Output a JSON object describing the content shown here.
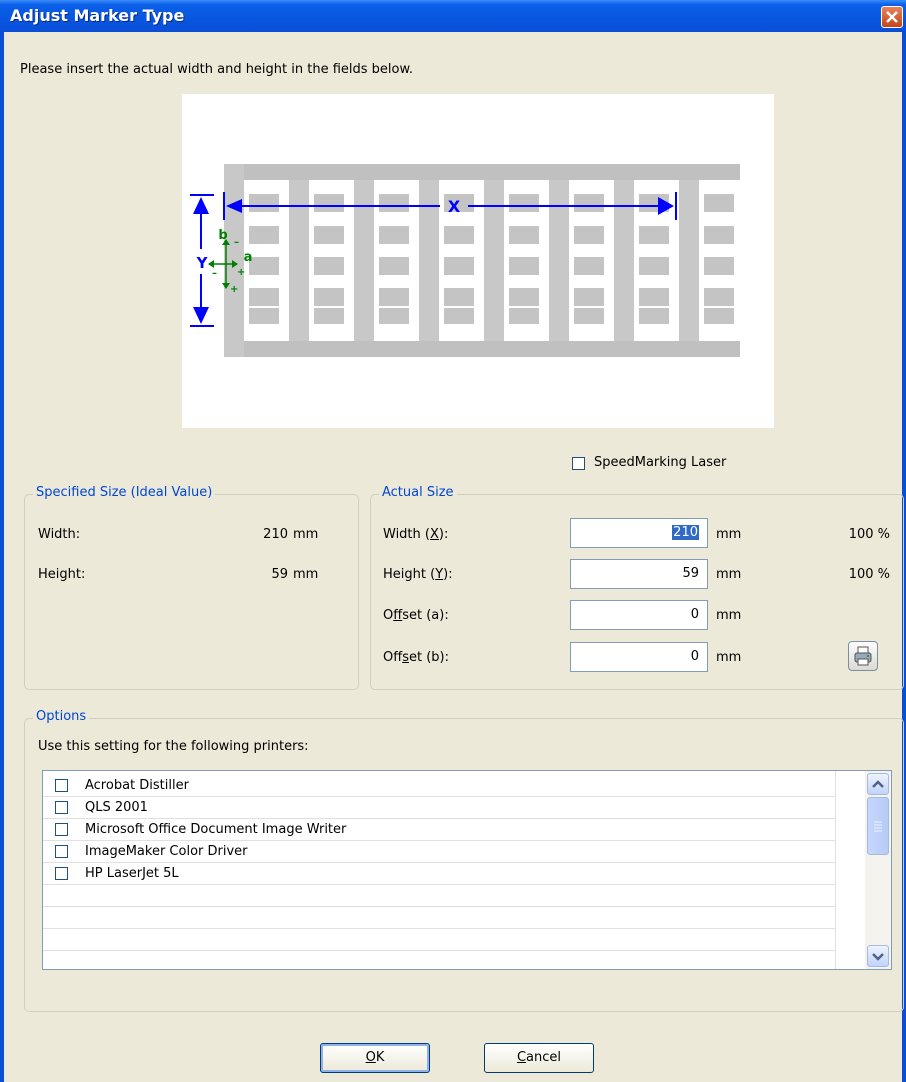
{
  "window": {
    "title": "Adjust Marker Type"
  },
  "instruction": "Please insert the actual width and height in the fields below.",
  "diagram": {
    "x_label": "X",
    "y_label": "Y",
    "a_label": "a",
    "b_label": "b",
    "plus": "+",
    "minus": "–"
  },
  "speedmarking": {
    "label": "SpeedMarking Laser",
    "checked": false
  },
  "specified": {
    "legend": "Specified Size (Ideal Value)",
    "width_label": "Width:",
    "width_value": "210",
    "width_unit": "mm",
    "height_label": "Height:",
    "height_value": "59",
    "height_unit": "mm"
  },
  "actual": {
    "legend": "Actual Size",
    "width_label_pre": "Width (",
    "width_label_key": "X",
    "width_label_post": "):",
    "width_value": "210",
    "width_unit": "mm",
    "width_pct": "100 %",
    "height_label_pre": "Height (",
    "height_label_key": "Y",
    "height_label_post": "):",
    "height_value": "59",
    "height_unit": "mm",
    "height_pct": "100 %",
    "offa_label_pre": "O",
    "offa_label_key": "f",
    "offa_label_post": "fset (a):",
    "offa_value": "0",
    "offa_unit": "mm",
    "offb_label_pre": "Off",
    "offb_label_key": "s",
    "offb_label_post": "et (b):",
    "offb_value": "0",
    "offb_unit": "mm"
  },
  "options": {
    "legend": "Options",
    "description": "Use this setting for the following printers:",
    "printers": [
      "Acrobat Distiller",
      "QLS 2001",
      "Microsoft Office Document Image Writer",
      "ImageMaker Color Driver",
      "HP LaserJet 5L"
    ]
  },
  "buttons": {
    "ok_key": "O",
    "ok_rest": "K",
    "cancel_key": "C",
    "cancel_rest": "ancel"
  },
  "colors": {
    "title_bar": "#0a4ed6",
    "group_legend": "#0046d5",
    "arrow_blue": "#0000ff",
    "arrow_green": "#008000",
    "marker_gray": "#c0c0c0"
  }
}
